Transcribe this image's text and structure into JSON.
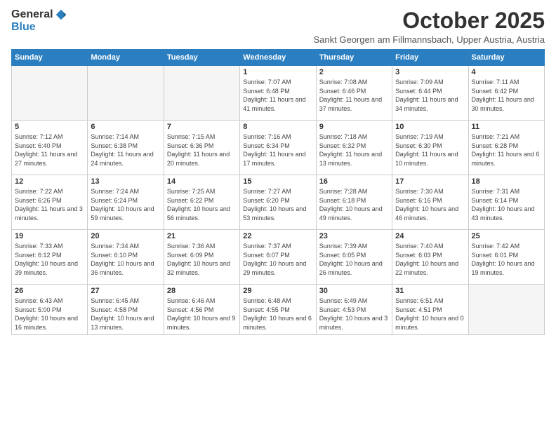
{
  "logo": {
    "general": "General",
    "blue": "Blue"
  },
  "title": "October 2025",
  "subtitle": "Sankt Georgen am Fillmannsbach, Upper Austria, Austria",
  "weekdays": [
    "Sunday",
    "Monday",
    "Tuesday",
    "Wednesday",
    "Thursday",
    "Friday",
    "Saturday"
  ],
  "weeks": [
    [
      {
        "day": "",
        "info": ""
      },
      {
        "day": "",
        "info": ""
      },
      {
        "day": "",
        "info": ""
      },
      {
        "day": "1",
        "info": "Sunrise: 7:07 AM\nSunset: 6:48 PM\nDaylight: 11 hours\nand 41 minutes."
      },
      {
        "day": "2",
        "info": "Sunrise: 7:08 AM\nSunset: 6:46 PM\nDaylight: 11 hours\nand 37 minutes."
      },
      {
        "day": "3",
        "info": "Sunrise: 7:09 AM\nSunset: 6:44 PM\nDaylight: 11 hours\nand 34 minutes."
      },
      {
        "day": "4",
        "info": "Sunrise: 7:11 AM\nSunset: 6:42 PM\nDaylight: 11 hours\nand 30 minutes."
      }
    ],
    [
      {
        "day": "5",
        "info": "Sunrise: 7:12 AM\nSunset: 6:40 PM\nDaylight: 11 hours\nand 27 minutes."
      },
      {
        "day": "6",
        "info": "Sunrise: 7:14 AM\nSunset: 6:38 PM\nDaylight: 11 hours\nand 24 minutes."
      },
      {
        "day": "7",
        "info": "Sunrise: 7:15 AM\nSunset: 6:36 PM\nDaylight: 11 hours\nand 20 minutes."
      },
      {
        "day": "8",
        "info": "Sunrise: 7:16 AM\nSunset: 6:34 PM\nDaylight: 11 hours\nand 17 minutes."
      },
      {
        "day": "9",
        "info": "Sunrise: 7:18 AM\nSunset: 6:32 PM\nDaylight: 11 hours\nand 13 minutes."
      },
      {
        "day": "10",
        "info": "Sunrise: 7:19 AM\nSunset: 6:30 PM\nDaylight: 11 hours\nand 10 minutes."
      },
      {
        "day": "11",
        "info": "Sunrise: 7:21 AM\nSunset: 6:28 PM\nDaylight: 11 hours\nand 6 minutes."
      }
    ],
    [
      {
        "day": "12",
        "info": "Sunrise: 7:22 AM\nSunset: 6:26 PM\nDaylight: 11 hours\nand 3 minutes."
      },
      {
        "day": "13",
        "info": "Sunrise: 7:24 AM\nSunset: 6:24 PM\nDaylight: 10 hours\nand 59 minutes."
      },
      {
        "day": "14",
        "info": "Sunrise: 7:25 AM\nSunset: 6:22 PM\nDaylight: 10 hours\nand 56 minutes."
      },
      {
        "day": "15",
        "info": "Sunrise: 7:27 AM\nSunset: 6:20 PM\nDaylight: 10 hours\nand 53 minutes."
      },
      {
        "day": "16",
        "info": "Sunrise: 7:28 AM\nSunset: 6:18 PM\nDaylight: 10 hours\nand 49 minutes."
      },
      {
        "day": "17",
        "info": "Sunrise: 7:30 AM\nSunset: 6:16 PM\nDaylight: 10 hours\nand 46 minutes."
      },
      {
        "day": "18",
        "info": "Sunrise: 7:31 AM\nSunset: 6:14 PM\nDaylight: 10 hours\nand 43 minutes."
      }
    ],
    [
      {
        "day": "19",
        "info": "Sunrise: 7:33 AM\nSunset: 6:12 PM\nDaylight: 10 hours\nand 39 minutes."
      },
      {
        "day": "20",
        "info": "Sunrise: 7:34 AM\nSunset: 6:10 PM\nDaylight: 10 hours\nand 36 minutes."
      },
      {
        "day": "21",
        "info": "Sunrise: 7:36 AM\nSunset: 6:09 PM\nDaylight: 10 hours\nand 32 minutes."
      },
      {
        "day": "22",
        "info": "Sunrise: 7:37 AM\nSunset: 6:07 PM\nDaylight: 10 hours\nand 29 minutes."
      },
      {
        "day": "23",
        "info": "Sunrise: 7:39 AM\nSunset: 6:05 PM\nDaylight: 10 hours\nand 26 minutes."
      },
      {
        "day": "24",
        "info": "Sunrise: 7:40 AM\nSunset: 6:03 PM\nDaylight: 10 hours\nand 22 minutes."
      },
      {
        "day": "25",
        "info": "Sunrise: 7:42 AM\nSunset: 6:01 PM\nDaylight: 10 hours\nand 19 minutes."
      }
    ],
    [
      {
        "day": "26",
        "info": "Sunrise: 6:43 AM\nSunset: 5:00 PM\nDaylight: 10 hours\nand 16 minutes."
      },
      {
        "day": "27",
        "info": "Sunrise: 6:45 AM\nSunset: 4:58 PM\nDaylight: 10 hours\nand 13 minutes."
      },
      {
        "day": "28",
        "info": "Sunrise: 6:46 AM\nSunset: 4:56 PM\nDaylight: 10 hours\nand 9 minutes."
      },
      {
        "day": "29",
        "info": "Sunrise: 6:48 AM\nSunset: 4:55 PM\nDaylight: 10 hours\nand 6 minutes."
      },
      {
        "day": "30",
        "info": "Sunrise: 6:49 AM\nSunset: 4:53 PM\nDaylight: 10 hours\nand 3 minutes."
      },
      {
        "day": "31",
        "info": "Sunrise: 6:51 AM\nSunset: 4:51 PM\nDaylight: 10 hours\nand 0 minutes."
      },
      {
        "day": "",
        "info": ""
      }
    ]
  ]
}
